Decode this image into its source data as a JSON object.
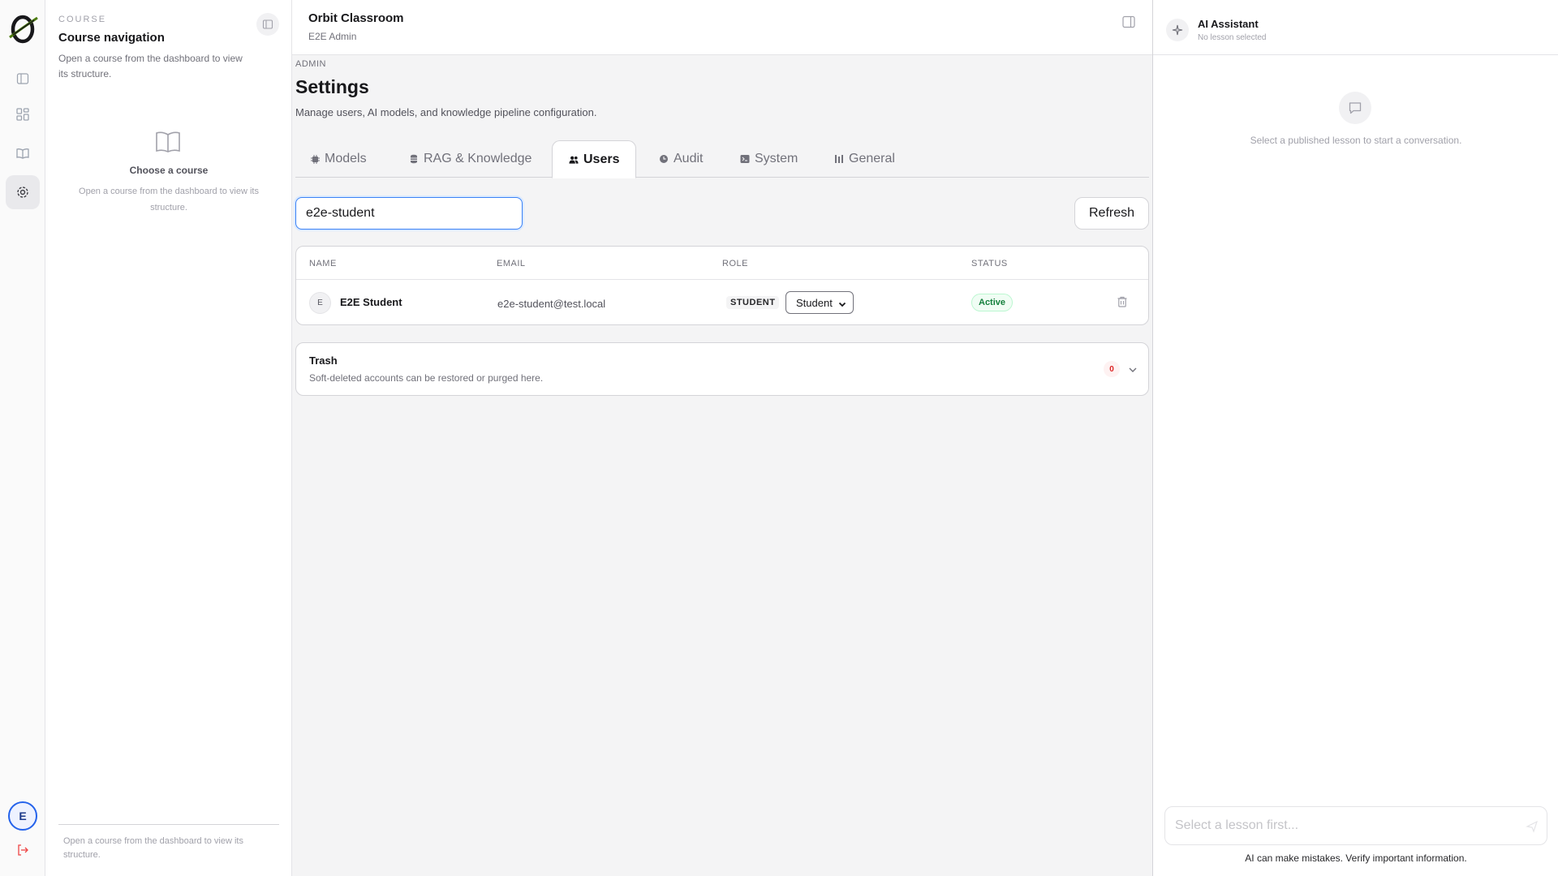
{
  "course_panel": {
    "eyebrow": "COURSE",
    "title": "Course navigation",
    "description": "Open a course from the dashboard to view its structure.",
    "empty_title": "Choose a course",
    "empty_description": "Open a course from the dashboard to view its structure.",
    "footer": "Open a course from the dashboard to view its structure."
  },
  "rail": {
    "avatar_initial": "E",
    "items": [
      "sidebar-toggle-icon",
      "dashboard-grid-icon",
      "book-icon",
      "gear-icon"
    ],
    "active_item": "gear-icon"
  },
  "header": {
    "app_title": "Orbit Classroom",
    "user_subtitle": "E2E Admin"
  },
  "page": {
    "eyebrow": "ADMIN",
    "title": "Settings",
    "description": "Manage users, AI models, and knowledge pipeline configuration."
  },
  "tabs": [
    {
      "label": "Models",
      "icon": "chip-icon"
    },
    {
      "label": "RAG & Knowledge",
      "icon": "database-icon"
    },
    {
      "label": "Users",
      "icon": "users-icon",
      "active": true
    },
    {
      "label": "Audit",
      "icon": "clock-icon"
    },
    {
      "label": "System",
      "icon": "terminal-icon"
    },
    {
      "label": "General",
      "icon": "sliders-icon"
    }
  ],
  "users": {
    "search_value": "e2e-student",
    "refresh_label": "Refresh",
    "columns": [
      "NAME",
      "EMAIL",
      "ROLE",
      "STATUS"
    ],
    "rows": [
      {
        "initial": "E",
        "name": "E2E Student",
        "email": "e2e-student@test.local",
        "role_chip": "STUDENT",
        "role_select": "Student",
        "status": "Active"
      }
    ]
  },
  "trash": {
    "title": "Trash",
    "description": "Soft-deleted accounts can be restored or purged here.",
    "count": "0"
  },
  "assistant": {
    "title": "AI Assistant",
    "subtitle": "No lesson selected",
    "empty_text": "Select a published lesson to start a conversation.",
    "input_placeholder": "Select a lesson first...",
    "disclaimer": "AI can make mistakes. Verify important information."
  },
  "colors": {
    "accent": "#2563eb",
    "active_status": "#15803d",
    "danger": "#dc2626"
  }
}
